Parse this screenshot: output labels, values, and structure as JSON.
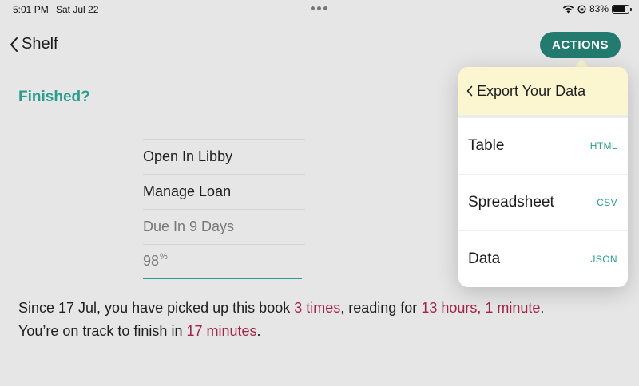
{
  "status_bar": {
    "time": "5:01 PM",
    "date": "Sat Jul 22",
    "battery": "83%",
    "battery_level": 0.83
  },
  "nav": {
    "back_label": "Shelf",
    "actions_label": "ACTIONS"
  },
  "page": {
    "heading": "Finished?",
    "menu": [
      {
        "label": "Open In Libby"
      },
      {
        "label": "Manage Loan"
      },
      {
        "label": "Due In 9 Days"
      }
    ],
    "progress": {
      "value": "98",
      "unit": "%",
      "fraction": 0.98
    },
    "summary": {
      "part1": "Since 17 Jul, you have picked up this book ",
      "times": "3 times",
      "part2": ", reading for ",
      "duration": "13 hours, 1 minute",
      "part3": ".",
      "part4": "You’re on track to finish in ",
      "remaining": "17 minutes",
      "part5": "."
    }
  },
  "popover": {
    "title": "Export Your Data",
    "items": [
      {
        "label": "Table",
        "format": "HTML"
      },
      {
        "label": "Spreadsheet",
        "format": "CSV"
      },
      {
        "label": "Data",
        "format": "JSON"
      }
    ]
  },
  "colors": {
    "accent": "#2a9d8f",
    "button": "#237a6e",
    "highlight": "#a3224a",
    "popover_header": "#fbf6cf"
  }
}
